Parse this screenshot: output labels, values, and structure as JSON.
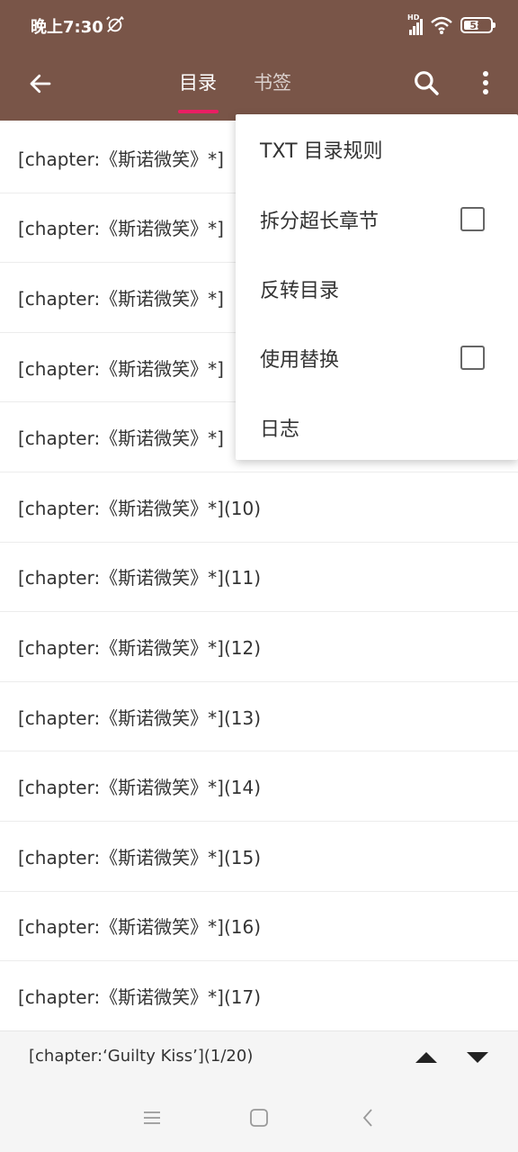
{
  "status_bar": {
    "time": "晚上7:30",
    "network": "HD",
    "battery": "58",
    "battery_level": 0.58
  },
  "app_bar": {
    "tabs": [
      {
        "label": "目录",
        "active": true
      },
      {
        "label": "书签",
        "active": false
      }
    ],
    "icons": [
      "arrow-back-icon",
      "search-icon",
      "more-vert-icon"
    ]
  },
  "chapters": [
    "[chapter:《斯诺微笑》*]",
    "[chapter:《斯诺微笑》*]",
    "[chapter:《斯诺微笑》*]",
    "[chapter:《斯诺微笑》*]",
    "[chapter:《斯诺微笑》*]",
    "[chapter:《斯诺微笑》*](10)",
    "[chapter:《斯诺微笑》*](11)",
    "[chapter:《斯诺微笑》*](12)",
    "[chapter:《斯诺微笑》*](13)",
    "[chapter:《斯诺微笑》*](14)",
    "[chapter:《斯诺微笑》*](15)",
    "[chapter:《斯诺微笑》*](16)",
    "[chapter:《斯诺微笑》*](17)"
  ],
  "menu": {
    "items": [
      {
        "label": "TXT 目录规则",
        "checkbox": false
      },
      {
        "label": "拆分超长章节",
        "checkbox": true,
        "checked": false
      },
      {
        "label": "反转目录",
        "checkbox": false
      },
      {
        "label": "使用替换",
        "checkbox": true,
        "checked": false
      },
      {
        "label": "日志",
        "checkbox": false
      }
    ]
  },
  "bottom_bar": {
    "current": "[chapter:‘Guilty Kiss’](1/20)"
  },
  "colors": {
    "primary": "#795548",
    "accent": "#e91e63",
    "text": "#333333"
  }
}
